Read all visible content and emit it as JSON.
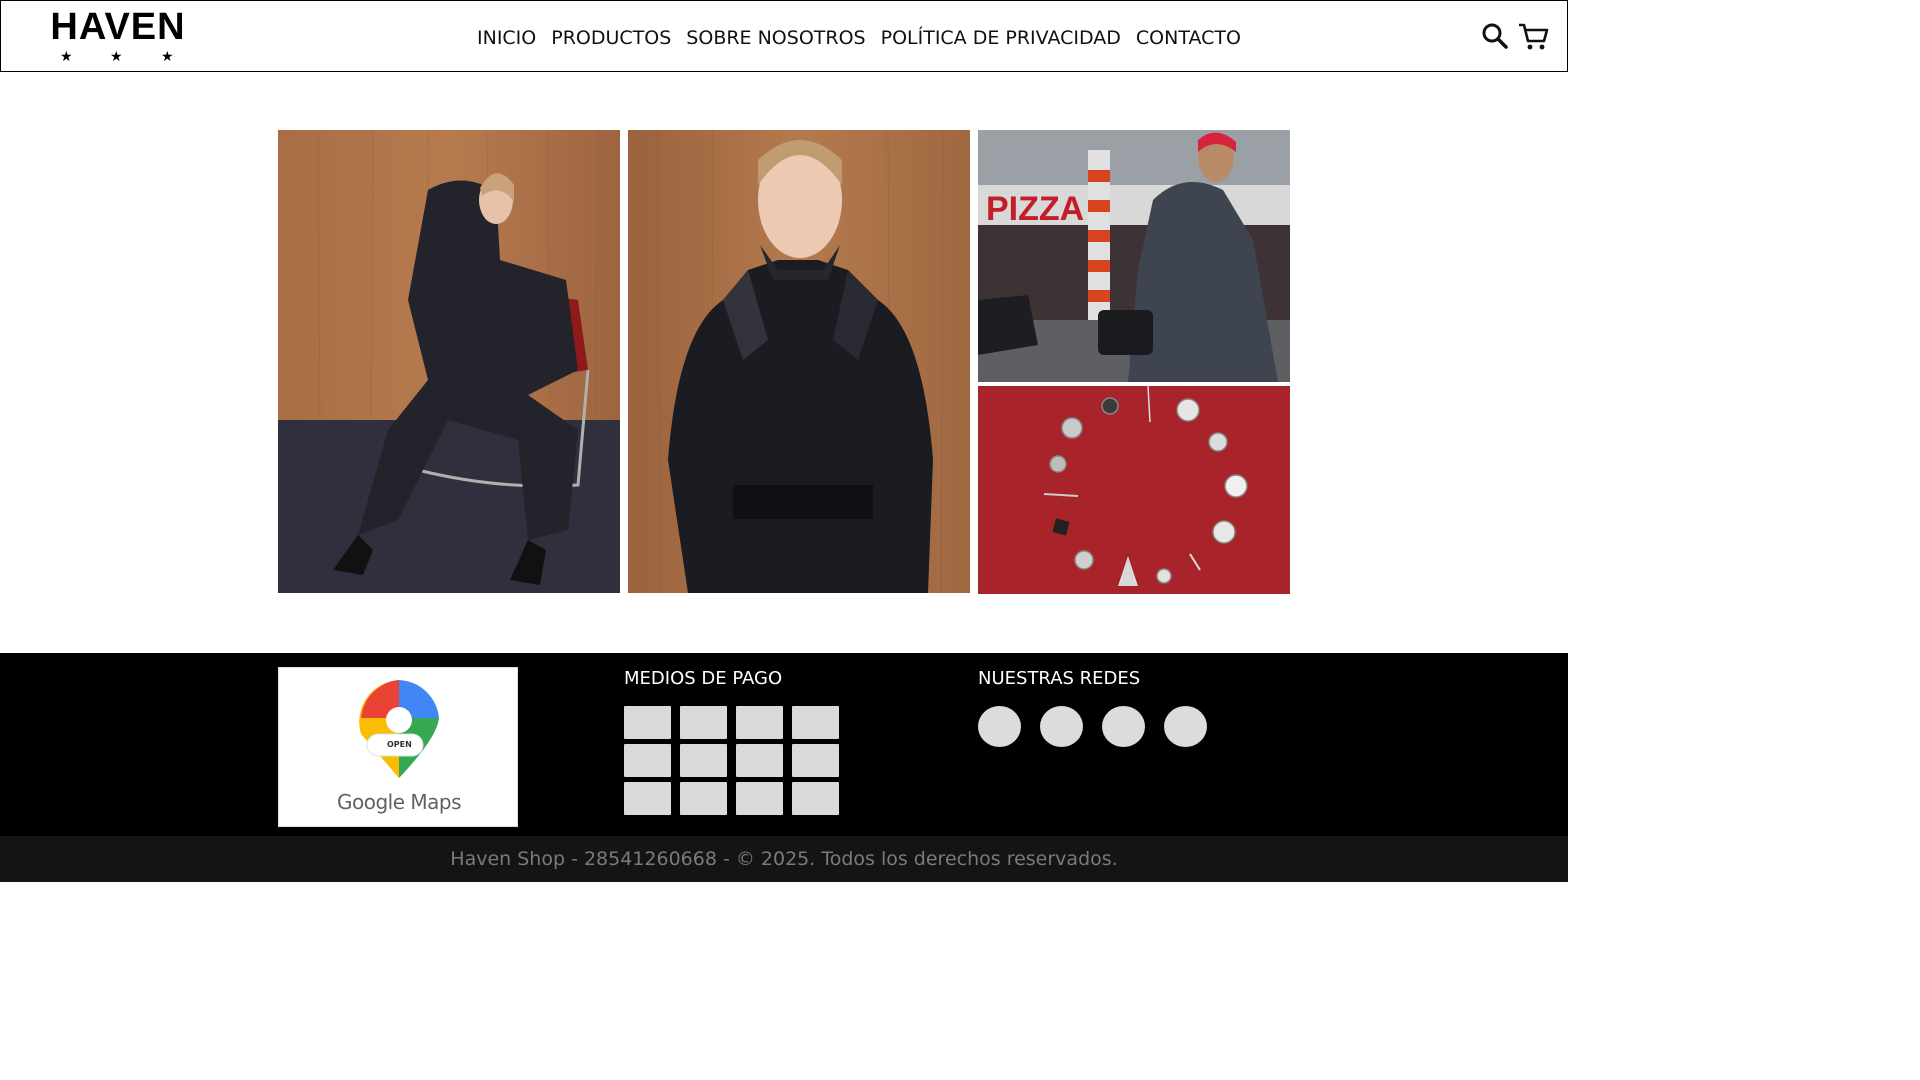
{
  "brand": {
    "logo_text": "HAVEN",
    "stars": [
      "★",
      "★",
      "★"
    ]
  },
  "nav": {
    "items": [
      {
        "label": "INICIO"
      },
      {
        "label": "PRODUCTOS"
      },
      {
        "label": "SOBRE NOSOTROS"
      },
      {
        "label": "POLÍTICA DE PRIVACIDAD"
      },
      {
        "label": "CONTACTO"
      }
    ]
  },
  "header_icons": {
    "search": "search-icon",
    "cart": "cart-icon"
  },
  "gallery": {
    "photos": [
      {
        "name": "model-seated-denim"
      },
      {
        "name": "model-leather-coat"
      },
      {
        "name": "model-street-pizza"
      },
      {
        "name": "buttons-on-red"
      }
    ],
    "street_sign_text": "PIZZA"
  },
  "footer": {
    "map": {
      "label": "Google Maps",
      "badge": "OPEN"
    },
    "payment_title": "MEDIOS DE PAGO",
    "payment_count": 12,
    "social_title": "NUESTRAS REDES",
    "social_count": 4,
    "copyright": "Haven Shop - 28541260668 - © 2025. Todos los derechos reservados."
  },
  "colors": {
    "header_bg": "#ffffff",
    "footer_bg": "#000000",
    "copyright_bg": "#141414",
    "placeholder": "#d9d9d9"
  }
}
